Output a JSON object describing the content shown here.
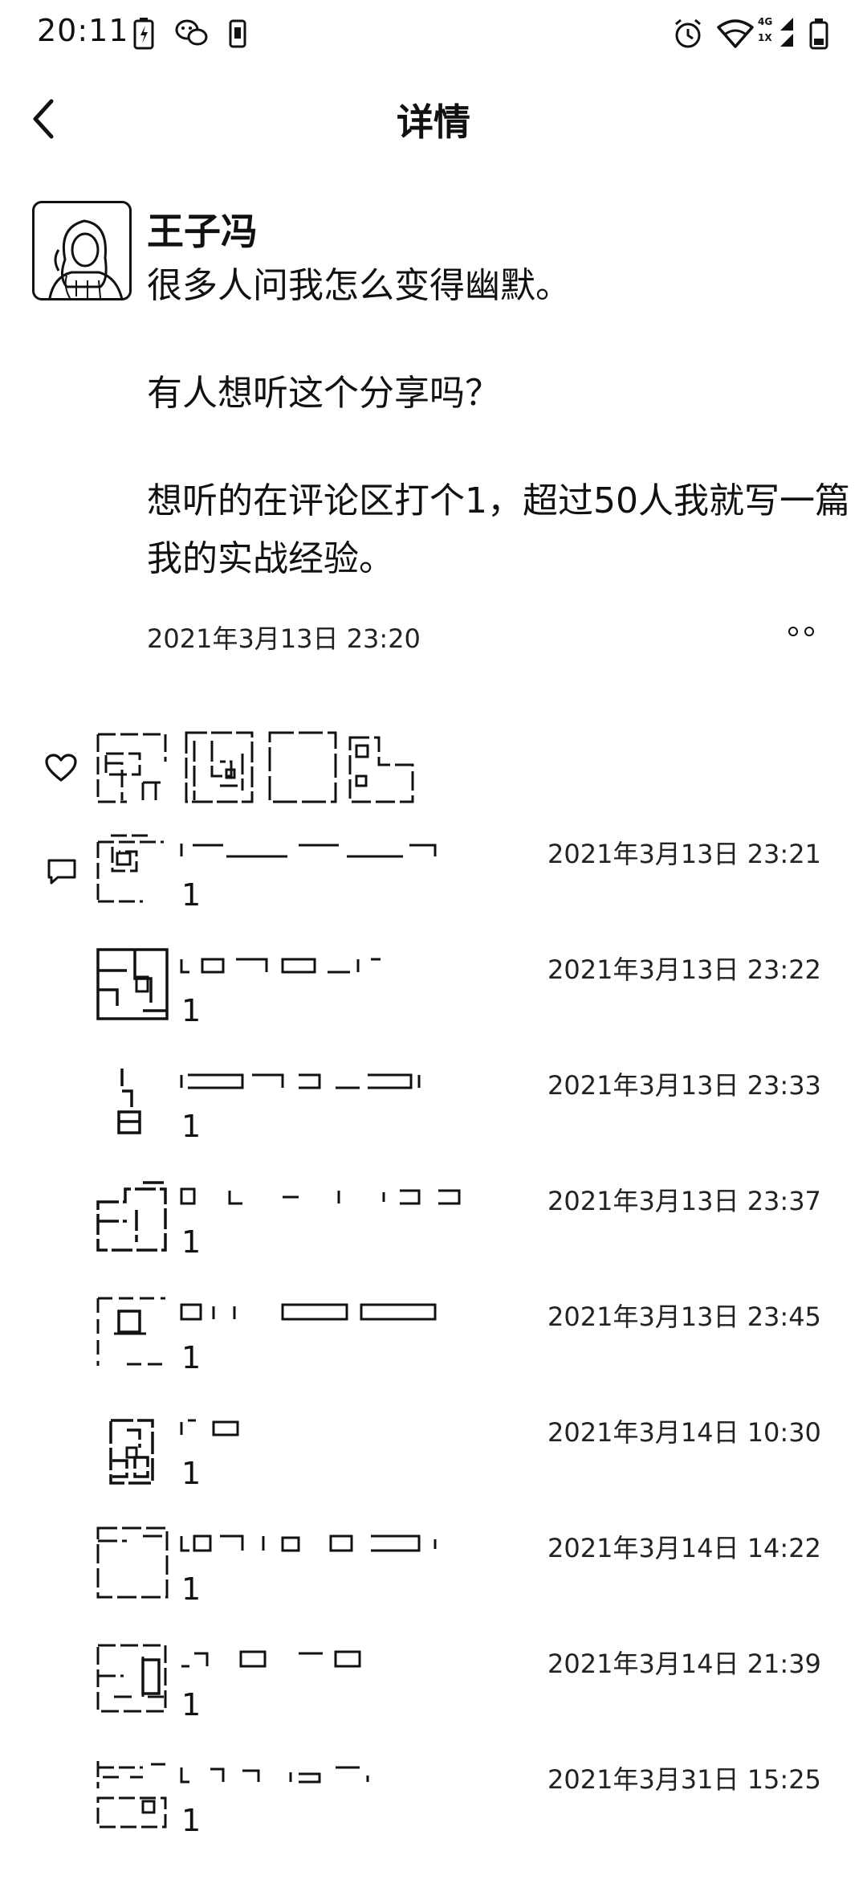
{
  "status_bar": {
    "time": "20:11",
    "signal_labels": {
      "top": "4G",
      "bottom": "1X"
    }
  },
  "nav": {
    "title": "详情"
  },
  "post": {
    "author": "王子冯",
    "paragraphs": [
      "很多人问我怎么变得幽默。",
      "有人想听这个分享吗？",
      "想听的在评论区打个1，超过50人我就写一篇我的实战经验。"
    ],
    "timestamp": "2021年3月13日 23:20"
  },
  "likes": {
    "icon": "heart-icon"
  },
  "comments": [
    {
      "text": "1",
      "time": "2021年3月13日 23:21"
    },
    {
      "text": "1",
      "time": "2021年3月13日 23:22"
    },
    {
      "text": "1",
      "time": "2021年3月13日 23:33"
    },
    {
      "text": "1",
      "time": "2021年3月13日 23:37"
    },
    {
      "text": "1",
      "time": "2021年3月13日 23:45"
    },
    {
      "text": "1",
      "time": "2021年3月14日 10:30"
    },
    {
      "text": "1",
      "time": "2021年3月14日 14:22"
    },
    {
      "text": "1",
      "time": "2021年3月14日 21:39"
    },
    {
      "text": "1",
      "time": "2021年3月31日 15:25"
    }
  ]
}
